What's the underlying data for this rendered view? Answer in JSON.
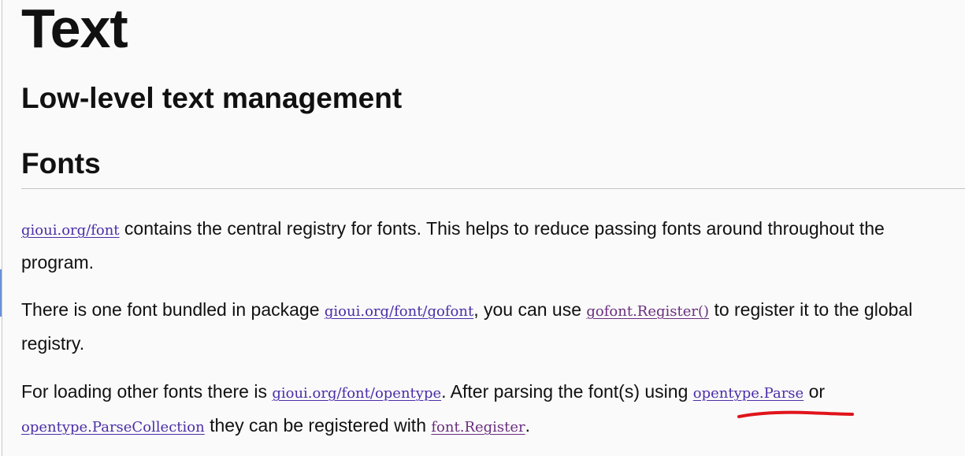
{
  "title": "Text",
  "subtitle": "Low-level text management",
  "section": {
    "heading": "Fonts"
  },
  "paragraph1": {
    "link": "gioui.org/font",
    "text": " contains the central registry for fonts. This helps to reduce passing fonts around throughout the program."
  },
  "paragraph2": {
    "text_a": "There is one font bundled in package ",
    "link_a": "gioui.org/font/gofont",
    "text_b": ", you can use ",
    "link_b": "gofont.Register()",
    "text_c": " to register it to the global registry."
  },
  "paragraph3": {
    "text_a": "For loading other fonts there is ",
    "link_a": "gioui.org/font/opentype",
    "text_b": ". After parsing the font(s) using ",
    "link_b": "opentype.Parse",
    "text_c": " or ",
    "link_c": "opentype.ParseCollection",
    "text_d": " they can be registered with ",
    "link_d": "font.Register",
    "text_e": "."
  },
  "colors": {
    "link": "#4b2ea7",
    "visited_link": "#6a2d7e",
    "annotation": "#e0141b",
    "background": "#fafafa"
  }
}
